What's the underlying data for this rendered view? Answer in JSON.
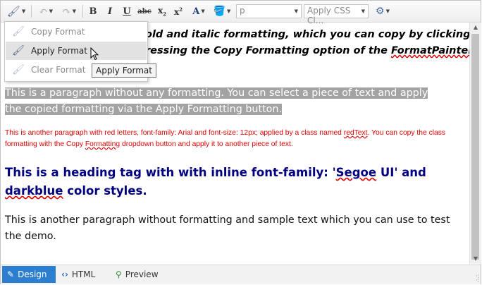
{
  "toolbar": {
    "style_combo": "p",
    "css_class_combo": "Apply CSS Cl..."
  },
  "menu": {
    "items": [
      "Copy Format",
      "Apply Format",
      "Clear Format"
    ]
  },
  "tooltip": "Apply Format",
  "content": {
    "p1_line1": "old and italic formatting, which you can copy by clicking",
    "p1_line2_a": "ressing the Copy Formatting option of the ",
    "p1_line2_b": "FormatPainter",
    "p2": "This is a paragraph without any formatting. You can select a piece of text and apply the copied formatting via the Apply Formatting button.",
    "p3_a": "This is another paragraph with red letters, font-family: Arial and font-size: 12px; applied by a class named ",
    "p3_b": "redText",
    "p3_c": ". You can copy the class formatting with the Copy ",
    "p3_d": "Formatting",
    "p3_e": " dropdown button and apply it to another piece of text.",
    "h2_a": "This is a heading tag with with inline font-family: '",
    "h2_b": "Segoe",
    "h2_c": " UI' and ",
    "h2_d": "darkblue",
    "h2_e": " color styles.",
    "p4": "This is another paragraph without formatting and sample text which you can use to test the demo."
  },
  "modes": {
    "design": "Design",
    "html": "HTML",
    "preview": "Preview"
  },
  "colors": {
    "accent": "#2c7fd0",
    "heading": "#000080",
    "red_text": "#e30000"
  }
}
